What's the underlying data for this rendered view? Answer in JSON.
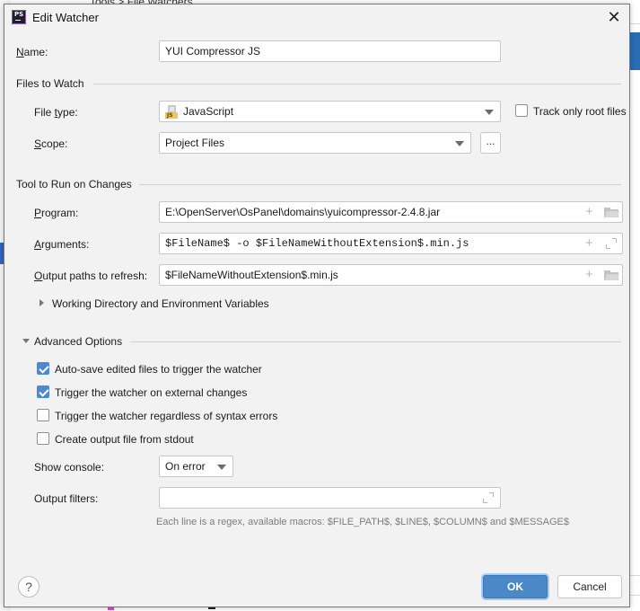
{
  "background": {
    "top_fragment": "Tools > File Watchers"
  },
  "dialog": {
    "title": "Edit Watcher",
    "close_icon": "close-icon",
    "name": {
      "label_accel": "N",
      "label_rest": "ame:",
      "value": "YUI Compressor JS"
    },
    "files_to_watch": {
      "section_title": "Files to Watch",
      "file_type": {
        "label_pre": "File ",
        "label_accel": "t",
        "label_rest": "ype:",
        "value": "JavaScript",
        "icon": "javascript-file-icon"
      },
      "track_only_root": {
        "label": "Track only root files",
        "checked": false
      },
      "scope": {
        "label_accel": "S",
        "label_rest": "cope:",
        "value": "Project Files",
        "browse_label": "..."
      }
    },
    "tool": {
      "section_title": "Tool to Run on Changes",
      "program": {
        "label_accel": "P",
        "label_rest": "rogram:",
        "value": "E:\\OpenServer\\OsPanel\\domains\\yuicompressor-2.4.8.jar"
      },
      "arguments": {
        "label_accel": "A",
        "label_rest": "rguments:",
        "value": "$FileName$ -o $FileNameWithoutExtension$.min.js"
      },
      "output_paths": {
        "label_accel": "O",
        "label_rest": "utput paths to refresh:",
        "value": "$FileNameWithoutExtension$.min.js"
      },
      "working_dir_label": "Working Directory and Environment Variables"
    },
    "advanced": {
      "section_title": "Advanced Options",
      "options": [
        {
          "label": "Auto-save edited files to trigger the watcher",
          "checked": true
        },
        {
          "label": "Trigger the watcher on external changes",
          "checked": true
        },
        {
          "label": "Trigger the watcher regardless of syntax errors",
          "checked": false
        },
        {
          "label": "Create output file from stdout",
          "checked": false
        }
      ],
      "show_console": {
        "label": "Show console:",
        "value": "On error"
      },
      "output_filters": {
        "label": "Output filters:",
        "value": ""
      },
      "hint": "Each line is a regex, available macros: $FILE_PATH$, $LINE$, $COLUMN$ and $MESSAGE$"
    },
    "footer": {
      "help_label": "?",
      "ok_label": "OK",
      "cancel_label": "Cancel"
    }
  },
  "colors": {
    "accent": "#4a88c7",
    "checkbox_checked": "#4a89d4",
    "dialog_bg": "#f2f2f2"
  }
}
